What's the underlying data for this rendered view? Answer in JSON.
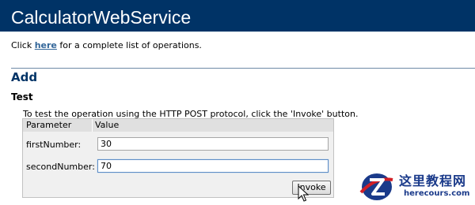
{
  "header": {
    "title": "CalculatorWebService"
  },
  "intro": {
    "prefix": "Click ",
    "link": "here",
    "suffix": " for a complete list of operations."
  },
  "operation": {
    "name": "Add",
    "test_heading": "Test",
    "instructions": "To test the operation using the HTTP POST protocol, click the 'Invoke' button.",
    "table": {
      "col_parameter": "Parameter",
      "col_value": "Value",
      "fields": [
        {
          "label": "firstNumber:",
          "value": "30"
        },
        {
          "label": "secondNumber:",
          "value": "70"
        }
      ]
    },
    "invoke_label": "Invoke"
  },
  "watermark": {
    "cn": "这里教程网",
    "en": "herecours.com"
  },
  "colors": {
    "header_bg": "#003366",
    "link": "#336699",
    "heading": "#003366"
  },
  "icons": {
    "cursor": "arrow-cursor-icon",
    "logo": "watermark-logo-icon"
  }
}
